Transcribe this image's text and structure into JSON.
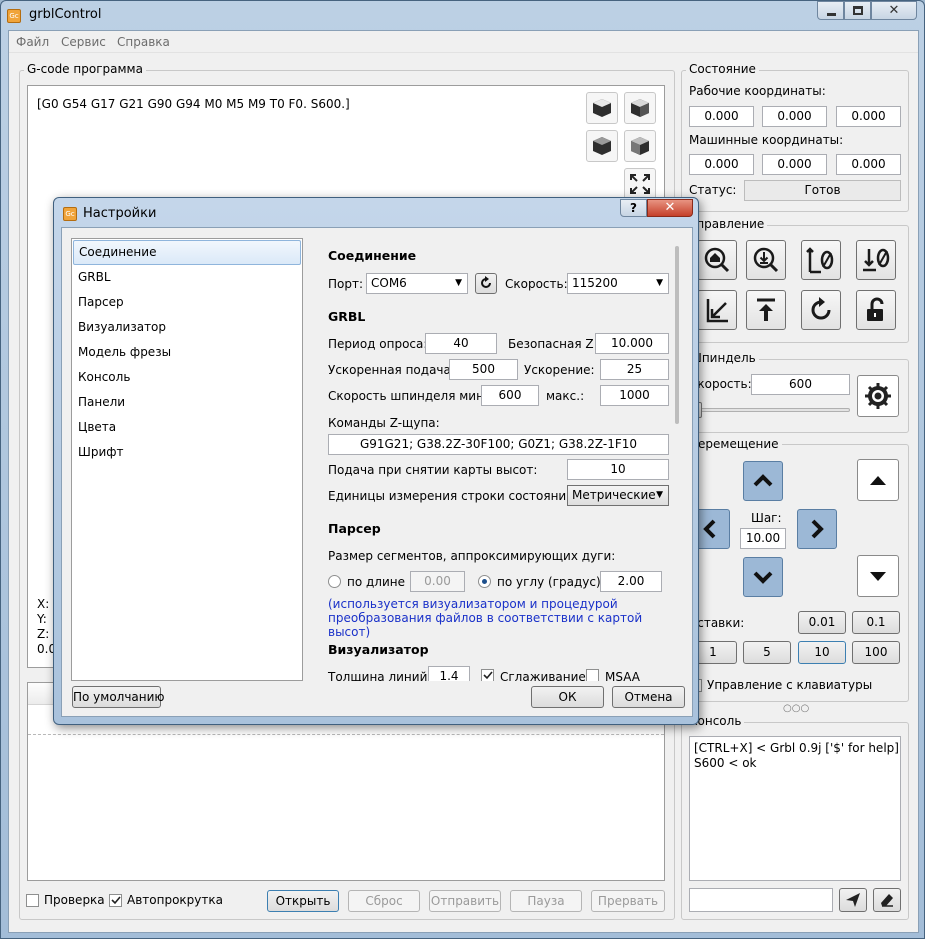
{
  "window": {
    "title": "grblControl",
    "app_icon_text": "Gc"
  },
  "menu": [
    "Файл",
    "Сервис",
    "Справка"
  ],
  "gcode": {
    "group_title": "G-code программа",
    "state_line": "[G0 G54 G17 G21 G90 G94 M0 M5 M9 T0 F0. S600.]",
    "coord_labels": [
      "X:",
      "Y:",
      "Z:",
      "0.0"
    ],
    "check_label": "Проверка",
    "autoscroll_label": "Автопрокрутка",
    "buttons": {
      "open": "Открыть",
      "reset": "Сброс",
      "send": "Отправить",
      "pause": "Пауза",
      "abort": "Прервать"
    }
  },
  "state": {
    "group_title": "Состояние",
    "work_label": "Рабочие координаты:",
    "work": [
      "0.000",
      "0.000",
      "0.000"
    ],
    "machine_label": "Машинные координаты:",
    "machine": [
      "0.000",
      "0.000",
      "0.000"
    ],
    "status_label": "Статус:",
    "status_value": "Готов"
  },
  "control": {
    "group_title": "Управление"
  },
  "spindle": {
    "group_title": "Шпиндель",
    "speed_label": "Скорость:",
    "speed_value": "600"
  },
  "jog": {
    "group_title": "Перемещение",
    "step_label": "Шаг:",
    "step_value": "10.00",
    "presets_label": "Вставки:",
    "presets_row1": [
      "0.01",
      "0.1"
    ],
    "presets_row2": [
      "1",
      "5",
      "10",
      "100"
    ],
    "keyboard_label": "Управление с клавиатуры",
    "dots": "○○○"
  },
  "console": {
    "group_title": "Консоль",
    "lines": [
      "[CTRL+X] < Grbl 0.9j ['$' for help]",
      "S600 < ok"
    ]
  },
  "dialog": {
    "title": "Настройки",
    "nav": [
      "Соединение",
      "GRBL",
      "Парсер",
      "Визуализатор",
      "Модель фрезы",
      "Консоль",
      "Панели",
      "Цвета",
      "Шрифт"
    ],
    "connection": {
      "title": "Соединение",
      "port_label": "Порт:",
      "port_value": "COM6",
      "speed_label": "Скорость:",
      "speed_value": "115200"
    },
    "grbl": {
      "title": "GRBL",
      "poll_label": "Период опроса:",
      "poll_value": "40",
      "safe_z_label": "Безопасная Z:",
      "safe_z_value": "10.000",
      "rapid_label": "Ускоренная подача:",
      "rapid_value": "500",
      "accel_label": "Ускорение:",
      "accel_value": "25",
      "spindle_min_label": "Скорость шпинделя мин.:",
      "spindle_min_value": "600",
      "spindle_max_label": "макс.:",
      "spindle_max_value": "1000",
      "probe_label": "Команды Z-щупа:",
      "probe_value": "G91G21; G38.2Z-30F100; G0Z1; G38.2Z-1F10",
      "heightmap_feed_label": "Подача при снятии карты высот:",
      "heightmap_feed_value": "10",
      "units_label": "Единицы измерения строки состояния:",
      "units_value": "Метрические"
    },
    "parser": {
      "title": "Парсер",
      "segments_label": "Размер сегментов, аппроксимирующих дуги:",
      "by_length_label": "по длине",
      "by_length_value": "0.00",
      "by_angle_label": "по углу (градус)",
      "by_angle_value": "2.00",
      "note": "(используется визуализатором и процедурой преобразования файлов в соответствии с картой высот)"
    },
    "visualizer": {
      "title": "Визуализатор",
      "line_width_label": "Толщина линий:",
      "line_width_value": "1.4",
      "smoothing_label": "Сглаживание",
      "msaa_label": "MSAA"
    },
    "buttons": {
      "defaults": "По умолчанию",
      "ok": "ОК",
      "cancel": "Отмена"
    }
  }
}
